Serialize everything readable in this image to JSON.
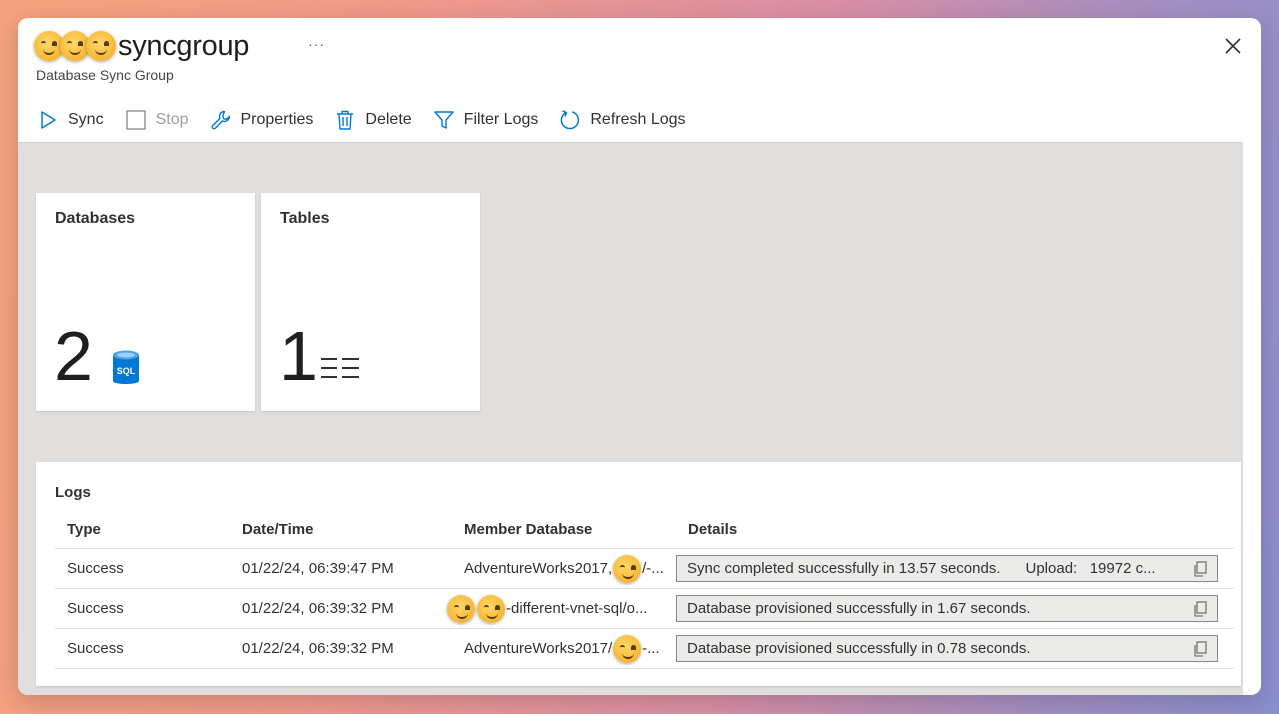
{
  "window": {
    "title": "syncgroup",
    "more_label": "···",
    "subtitle": "Database Sync Group"
  },
  "toolbar": {
    "sync_label": "Sync",
    "stop_label": "Stop",
    "properties_label": "Properties",
    "delete_label": "Delete",
    "filter_logs_label": "Filter Logs",
    "refresh_logs_label": "Refresh Logs"
  },
  "tiles": {
    "databases": {
      "title": "Databases",
      "value": "2",
      "icon": "sql-database-icon"
    },
    "tables": {
      "title": "Tables",
      "value": "1",
      "icon": "table-lines-icon"
    }
  },
  "logs": {
    "title": "Logs",
    "columns": [
      "Type",
      "Date/Time",
      "Member Database",
      "Details"
    ],
    "rows": [
      {
        "type": "Success",
        "datetime": "01/22/24, 06:39:47 PM",
        "member_prefix": "AdventureWorks2017,",
        "member_suffix": "/-...",
        "details": "Sync completed successfully in 13.57 seconds.      Upload:   19972 c..."
      },
      {
        "type": "Success",
        "datetime": "01/22/24, 06:39:32 PM",
        "member_prefix": "",
        "member_suffix": "-different-vnet-sql/o...",
        "details": "Database provisioned successfully in 1.67 seconds."
      },
      {
        "type": "Success",
        "datetime": "01/22/24, 06:39:32 PM",
        "member_prefix": "AdventureWorks2017/",
        "member_suffix": "-...",
        "details": "Database provisioned successfully in 0.78 seconds."
      }
    ]
  },
  "colors": {
    "accent": "#0078d4",
    "tile_bg": "#ffffff",
    "content_bg": "#e1dfdd"
  }
}
